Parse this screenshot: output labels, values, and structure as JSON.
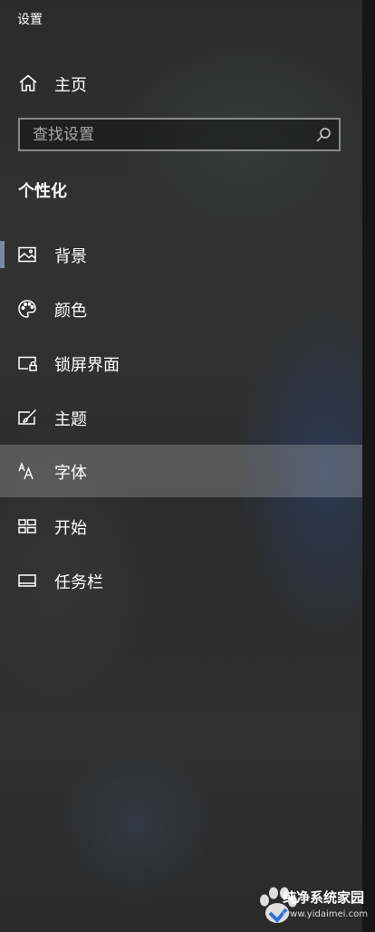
{
  "app": {
    "title": "设置"
  },
  "home": {
    "label": "主页",
    "icon": "home-icon"
  },
  "search": {
    "placeholder": "查找设置",
    "value": "",
    "icon": "search-icon"
  },
  "section": {
    "title": "个性化"
  },
  "nav": {
    "items": [
      {
        "label": "背景",
        "icon": "picture-icon",
        "selected": true
      },
      {
        "label": "颜色",
        "icon": "palette-icon"
      },
      {
        "label": "锁屏界面",
        "icon": "lock-screen-icon"
      },
      {
        "label": "主题",
        "icon": "theme-brush-icon"
      },
      {
        "label": "字体",
        "icon": "font-icon",
        "hovered": true
      },
      {
        "label": "开始",
        "icon": "start-icon"
      },
      {
        "label": "任务栏",
        "icon": "taskbar-icon"
      }
    ]
  },
  "watermark": {
    "name": "纯净系统家园",
    "url": "www.yidaimei.com"
  },
  "colors": {
    "accent": "#7a8aa0",
    "text": "#ffffff",
    "search_border": "#8a8a8a"
  }
}
